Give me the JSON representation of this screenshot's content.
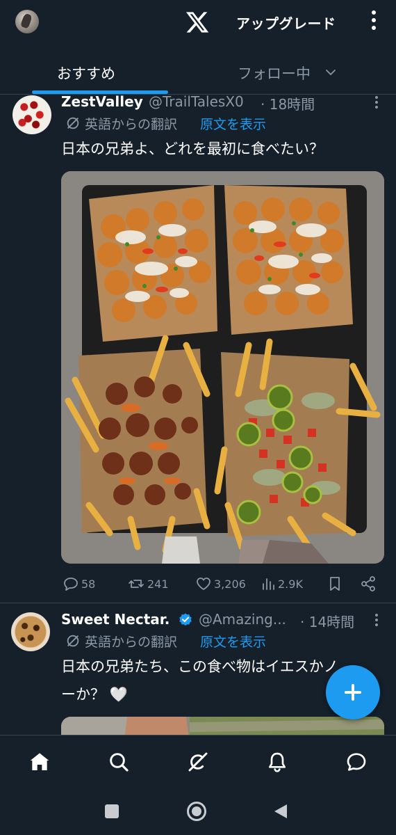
{
  "header": {
    "x_logo": "x-logo",
    "upgrade_label": "アップグレード"
  },
  "tabs": {
    "recommended": "おすすめ",
    "following": "フォロー中"
  },
  "tweets": [
    {
      "name": "ZestValley",
      "handle": "@TrailTalesX0",
      "time": "· 18時間",
      "translated_label": "英語からの翻訳",
      "show_original": "原文を表示",
      "body": "日本の兄弟よ、どれを最初に食べたい？",
      "image_alt": "four trays of loaded fries and tater tots",
      "replies": "58",
      "reposts": "241",
      "likes": "3,206",
      "views": "2.9K"
    },
    {
      "name": "Sweet Nectar.",
      "handle": "@Amazing...",
      "time": "· 14時間",
      "verified": true,
      "translated_label": "英語からの翻訳",
      "show_original": "原文を表示",
      "body_line1": "日本の兄弟たち、この食べ物はイエスかノ",
      "body_line2": "ーか？ 🤍"
    }
  ],
  "fab_icon": "plus-icon",
  "nav": [
    "home-icon",
    "search-icon",
    "grok-icon",
    "notifications-icon",
    "messages-icon"
  ],
  "system_nav": [
    "recents-button",
    "home-button",
    "back-button"
  ],
  "colors": {
    "background": "#15202b",
    "accent": "#1d9bf0",
    "muted": "#8b98a5",
    "divider": "#38444d"
  }
}
